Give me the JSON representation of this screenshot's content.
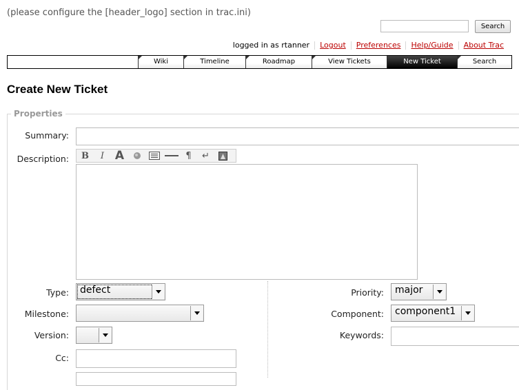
{
  "header": {
    "logo_note": "(please configure the [header_logo] section in trac.ini)",
    "search_button": "Search",
    "search_value": ""
  },
  "metanav": {
    "logged_in": "logged in as rtanner",
    "logout": "Logout",
    "preferences": "Preferences",
    "help": "Help/Guide",
    "about": "About Trac"
  },
  "mainnav": {
    "wiki": "Wiki",
    "timeline": "Timeline",
    "roadmap": "Roadmap",
    "view_tickets": "View Tickets",
    "new_ticket": "New Ticket",
    "search": "Search"
  },
  "page_title": "Create New Ticket",
  "properties": {
    "legend": "Properties",
    "summary_label": "Summary:",
    "description_label": "Description:",
    "type_label": "Type:",
    "type_value": "defect",
    "milestone_label": "Milestone:",
    "milestone_value": "",
    "version_label": "Version:",
    "version_value": "",
    "cc_label": "Cc:",
    "priority_label": "Priority:",
    "priority_value": "major",
    "component_label": "Component:",
    "component_value": "component1",
    "keywords_label": "Keywords:"
  },
  "toolbar": {
    "bold": "B",
    "italic": "I",
    "heading": "A",
    "paragraph": "¶",
    "linebreak": "↵"
  }
}
